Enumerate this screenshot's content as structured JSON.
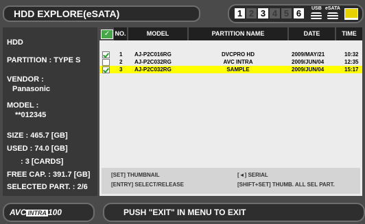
{
  "header": {
    "title": "HDD EXPLORE(eSATA)",
    "slots": [
      {
        "label": "1",
        "active": true
      },
      {
        "label": "2",
        "active": false
      },
      {
        "label": "3",
        "active": true
      },
      {
        "label": "4",
        "active": false
      },
      {
        "label": "5",
        "active": false
      },
      {
        "label": "6",
        "active": true
      }
    ],
    "usb_label": "USB",
    "esata_label": "eSATA"
  },
  "info": {
    "device": "HDD",
    "partition": "PARTITION : TYPE S",
    "vendor_label": "VENDOR :",
    "vendor_value": "Panasonic",
    "model_label": "MODEL :",
    "model_value": "**012345",
    "size": "SIZE : 465.7 [GB]",
    "used": "USED : 74.0 [GB]",
    "cards": ": 3 [CARDS]",
    "free": "FREE CAP. : 391.7 [GB]",
    "selected": "SELECTED PART. : 2/6"
  },
  "table": {
    "columns": [
      "NO.",
      "MODEL",
      "PARTITION NAME",
      "DATE",
      "TIME"
    ],
    "rows": [
      {
        "checked": true,
        "no": "1",
        "model": "AJ-P2C016RG",
        "name": "DVCPRO HD",
        "date": "2009/MAY/21",
        "time": "10:32",
        "selected": false
      },
      {
        "checked": false,
        "no": "2",
        "model": "AJ-P2C032RG",
        "name": "AVC INTRA",
        "date": "2009/JUN/04",
        "time": "12:35",
        "selected": false
      },
      {
        "checked": true,
        "no": "3",
        "model": "AJ-P2C032RG",
        "name": "SAMPLE",
        "date": "2009/JUN/04",
        "time": "15:17",
        "selected": true
      }
    ]
  },
  "guide": {
    "set_thumb": "[SET] THUMBNAIL",
    "serial": "[◄] SERIAL",
    "entry": "[ENTRY] SELECT/RELEASE",
    "shift_set": "[SHIFT+SET] THUMB. ALL SEL PART."
  },
  "footer": {
    "logo_left": "AVC",
    "logo_mid": "INTRA",
    "logo_right": "100",
    "message": "PUSH \"EXIT\" IN MENU TO EXIT"
  },
  "colors": {
    "selected_row": "#ffff00",
    "check_green": "#45a74a",
    "chip_yellow": "#e6d200"
  }
}
